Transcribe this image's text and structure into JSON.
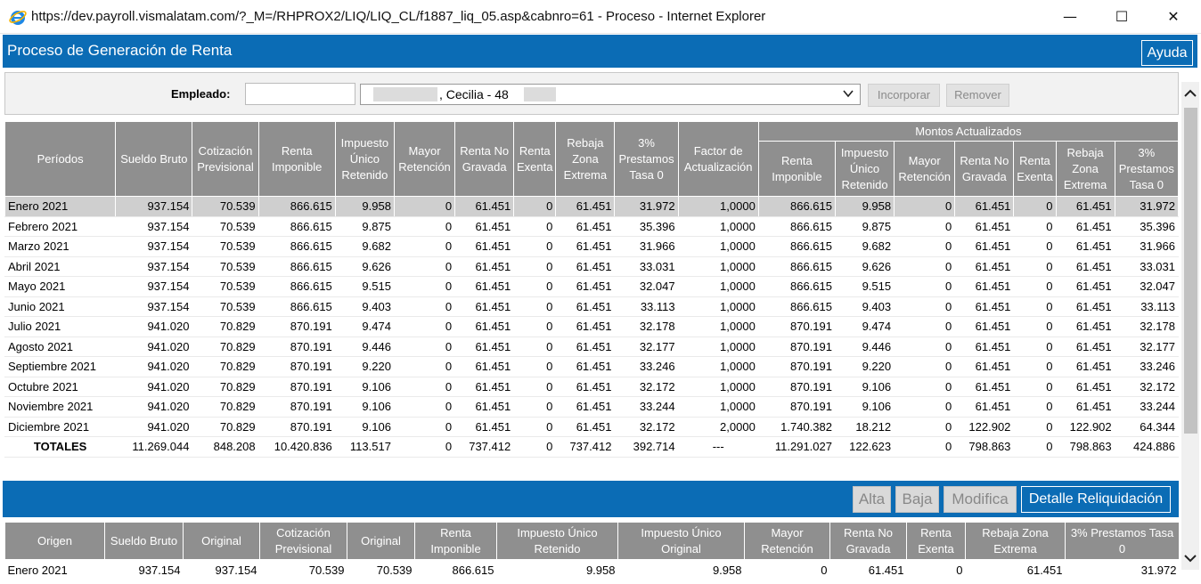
{
  "window": {
    "title": "https://dev.payroll.vismalatam.com/?_M=/RHPROX2/LIQ/LIQ_CL/f1887_liq_05.asp&cabnro=61 - Proceso - Internet Explorer",
    "icon": "internet-explorer-icon",
    "minimize": "—",
    "maximize": "☐",
    "close": "✕"
  },
  "header": {
    "title": "Proceso de Generación de Renta",
    "help_label": "Ayuda"
  },
  "employee": {
    "label": "Empleado:",
    "input_value": "",
    "selected_text": ", Cecilia - 48          -4",
    "incorporar_label": "Incorporar",
    "remover_label": "Remover"
  },
  "main_table": {
    "headers": {
      "periodos": "Períodos",
      "sueldo_bruto": "Sueldo Bruto",
      "cotizacion": "Cotización Previsional",
      "renta_imponible": "Renta Imponible",
      "impuesto": "Impuesto Único Retenido",
      "mayor_retencion": "Mayor Retención",
      "renta_no_gravada": "Renta No Gravada",
      "renta_exenta": "Renta Exenta",
      "rebaja_zona": "Rebaja Zona Extrema",
      "prestamos": "3% Prestamos Tasa 0",
      "factor": "Factor de Actualización",
      "montos_actualizados": "Montos Actualizados",
      "u_renta_imponible": "Renta Imponible",
      "u_impuesto": "Impuesto Único Retenido",
      "u_mayor_retencion": "Mayor Retención",
      "u_renta_no_gravada": "Renta No Gravada",
      "u_renta_exenta": "Renta Exenta",
      "u_rebaja_zona": "Rebaja Zona Extrema",
      "u_prestamos": "3% Prestamos Tasa 0"
    },
    "rows": [
      [
        "Enero 2021",
        "937.154",
        "70.539",
        "866.615",
        "9.958",
        "0",
        "61.451",
        "0",
        "61.451",
        "31.972",
        "1,0000",
        "866.615",
        "9.958",
        "0",
        "61.451",
        "0",
        "61.451",
        "31.972"
      ],
      [
        "Febrero 2021",
        "937.154",
        "70.539",
        "866.615",
        "9.875",
        "0",
        "61.451",
        "0",
        "61.451",
        "35.396",
        "1,0000",
        "866.615",
        "9.875",
        "0",
        "61.451",
        "0",
        "61.451",
        "35.396"
      ],
      [
        "Marzo 2021",
        "937.154",
        "70.539",
        "866.615",
        "9.682",
        "0",
        "61.451",
        "0",
        "61.451",
        "31.966",
        "1,0000",
        "866.615",
        "9.682",
        "0",
        "61.451",
        "0",
        "61.451",
        "31.966"
      ],
      [
        "Abril 2021",
        "937.154",
        "70.539",
        "866.615",
        "9.626",
        "0",
        "61.451",
        "0",
        "61.451",
        "33.031",
        "1,0000",
        "866.615",
        "9.626",
        "0",
        "61.451",
        "0",
        "61.451",
        "33.031"
      ],
      [
        "Mayo 2021",
        "937.154",
        "70.539",
        "866.615",
        "9.515",
        "0",
        "61.451",
        "0",
        "61.451",
        "32.047",
        "1,0000",
        "866.615",
        "9.515",
        "0",
        "61.451",
        "0",
        "61.451",
        "32.047"
      ],
      [
        "Junio 2021",
        "937.154",
        "70.539",
        "866.615",
        "9.403",
        "0",
        "61.451",
        "0",
        "61.451",
        "33.113",
        "1,0000",
        "866.615",
        "9.403",
        "0",
        "61.451",
        "0",
        "61.451",
        "33.113"
      ],
      [
        "Julio 2021",
        "941.020",
        "70.829",
        "870.191",
        "9.474",
        "0",
        "61.451",
        "0",
        "61.451",
        "32.178",
        "1,0000",
        "870.191",
        "9.474",
        "0",
        "61.451",
        "0",
        "61.451",
        "32.178"
      ],
      [
        "Agosto 2021",
        "941.020",
        "70.829",
        "870.191",
        "9.446",
        "0",
        "61.451",
        "0",
        "61.451",
        "32.177",
        "1,0000",
        "870.191",
        "9.446",
        "0",
        "61.451",
        "0",
        "61.451",
        "32.177"
      ],
      [
        "Septiembre 2021",
        "941.020",
        "70.829",
        "870.191",
        "9.220",
        "0",
        "61.451",
        "0",
        "61.451",
        "33.246",
        "1,0000",
        "870.191",
        "9.220",
        "0",
        "61.451",
        "0",
        "61.451",
        "33.246"
      ],
      [
        "Octubre 2021",
        "941.020",
        "70.829",
        "870.191",
        "9.106",
        "0",
        "61.451",
        "0",
        "61.451",
        "32.172",
        "1,0000",
        "870.191",
        "9.106",
        "0",
        "61.451",
        "0",
        "61.451",
        "32.172"
      ],
      [
        "Noviembre 2021",
        "941.020",
        "70.829",
        "870.191",
        "9.106",
        "0",
        "61.451",
        "0",
        "61.451",
        "33.244",
        "1,0000",
        "870.191",
        "9.106",
        "0",
        "61.451",
        "0",
        "61.451",
        "33.244"
      ],
      [
        "Diciembre 2021",
        "941.020",
        "70.829",
        "870.191",
        "9.106",
        "0",
        "61.451",
        "0",
        "61.451",
        "32.172",
        "2,0000",
        "1.740.382",
        "18.212",
        "0",
        "122.902",
        "0",
        "122.902",
        "64.344"
      ]
    ],
    "totals": [
      "TOTALES",
      "11.269.044",
      "848.208",
      "10.420.836",
      "113.517",
      "0",
      "737.412",
      "0",
      "737.412",
      "392.714",
      "---",
      "11.291.027",
      "122.623",
      "0",
      "798.863",
      "0",
      "798.863",
      "424.886"
    ]
  },
  "actions": {
    "alta_label": "Alta",
    "baja_label": "Baja",
    "modifica_label": "Modifica",
    "detalle_label": "Detalle Reliquidación"
  },
  "detail_table": {
    "headers": [
      "Origen",
      "Sueldo Bruto",
      "Original",
      "Cotización Previsional",
      "Original",
      "Renta Imponible",
      "Impuesto Único Retenido",
      "Impuesto Único Original",
      "Mayor Retención",
      "Renta No Gravada",
      "Renta Exenta",
      "Rebaja Zona Extrema",
      "3% Prestamos Tasa 0"
    ],
    "rows": [
      [
        "Enero 2021",
        "937.154",
        "937.154",
        "70.539",
        "70.539",
        "866.615",
        "9.958",
        "9.958",
        "0",
        "61.451",
        "0",
        "61.451",
        "31.972"
      ]
    ]
  },
  "colors": {
    "accent_blue": "#0b6cb5",
    "header_gray": "#8f8f8f",
    "selected_row": "#cfcfcf"
  }
}
